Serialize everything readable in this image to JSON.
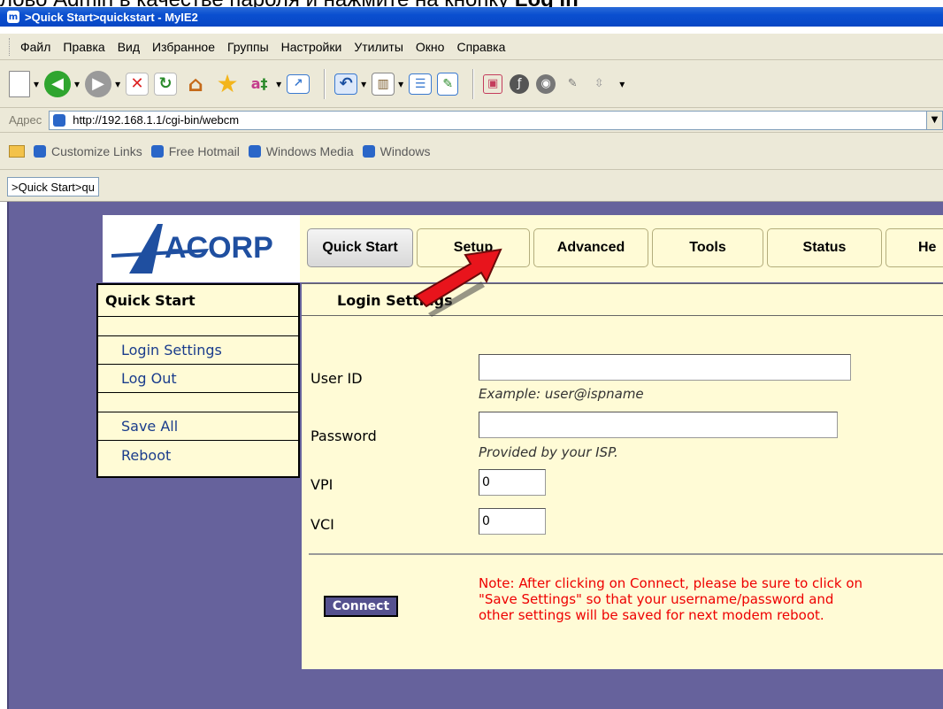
{
  "caption": {
    "text_before": "лово Admin в качестве пароля и нажмите на кнопку ",
    "text_bold": "Log In"
  },
  "window": {
    "title": ">Quick Start>quickstart - MyIE2",
    "app_icon": "myie2-icon"
  },
  "menu": {
    "items": [
      "Файл",
      "Правка",
      "Вид",
      "Избранное",
      "Группы",
      "Настройки",
      "Утилиты",
      "Окно",
      "Справка"
    ]
  },
  "toolbar": {
    "icons": [
      "new-page-icon",
      "back-icon",
      "forward-icon",
      "stop-icon",
      "refresh-icon",
      "home-icon",
      "favorites-icon",
      "translate-icon",
      "fullscreen-icon",
      "undo-icon",
      "tools-icon",
      "list-icon",
      "edit-icon",
      "image-icon",
      "flash-icon",
      "sound-icon",
      "brush-icon",
      "arrows-icon"
    ]
  },
  "address": {
    "label": "Адрес",
    "url": "http://192.168.1.1/cgi-bin/webcm"
  },
  "links": {
    "items": [
      "Customize Links",
      "Free Hotmail",
      "Windows Media",
      "Windows"
    ]
  },
  "tab": {
    "label": ">Quick Start>qu"
  },
  "router": {
    "logo_text": "ACORP",
    "nav": [
      "Quick Start",
      "Setup",
      "Advanced",
      "Tools",
      "Status",
      "He"
    ],
    "active_nav": "Quick Start",
    "sidebar": {
      "heading": "Quick Start",
      "items": [
        "Login Settings",
        "Log Out",
        "Save All",
        "Reboot"
      ]
    },
    "section_title": "Login Settings",
    "form": {
      "user_id_label": "User ID",
      "user_id_value": "",
      "user_id_hint": "Example: user@ispname",
      "password_label": "Password",
      "password_value": "",
      "password_hint": "Provided by your ISP.",
      "vpi_label": "VPI",
      "vpi_value": "0",
      "vci_label": "VCI",
      "vci_value": "0"
    },
    "connect_label": "Connect",
    "note": "Note: After clicking on Connect, please be sure to click on\n\"Save Settings\" so that your username/password and\nother settings will be saved for next modem reboot."
  },
  "colors": {
    "page_background": "#66629c",
    "panel": "#fffbd6",
    "accent_blue": "#1a3c8c",
    "note_red": "#e00000",
    "pointer_red": "#e8141c"
  }
}
